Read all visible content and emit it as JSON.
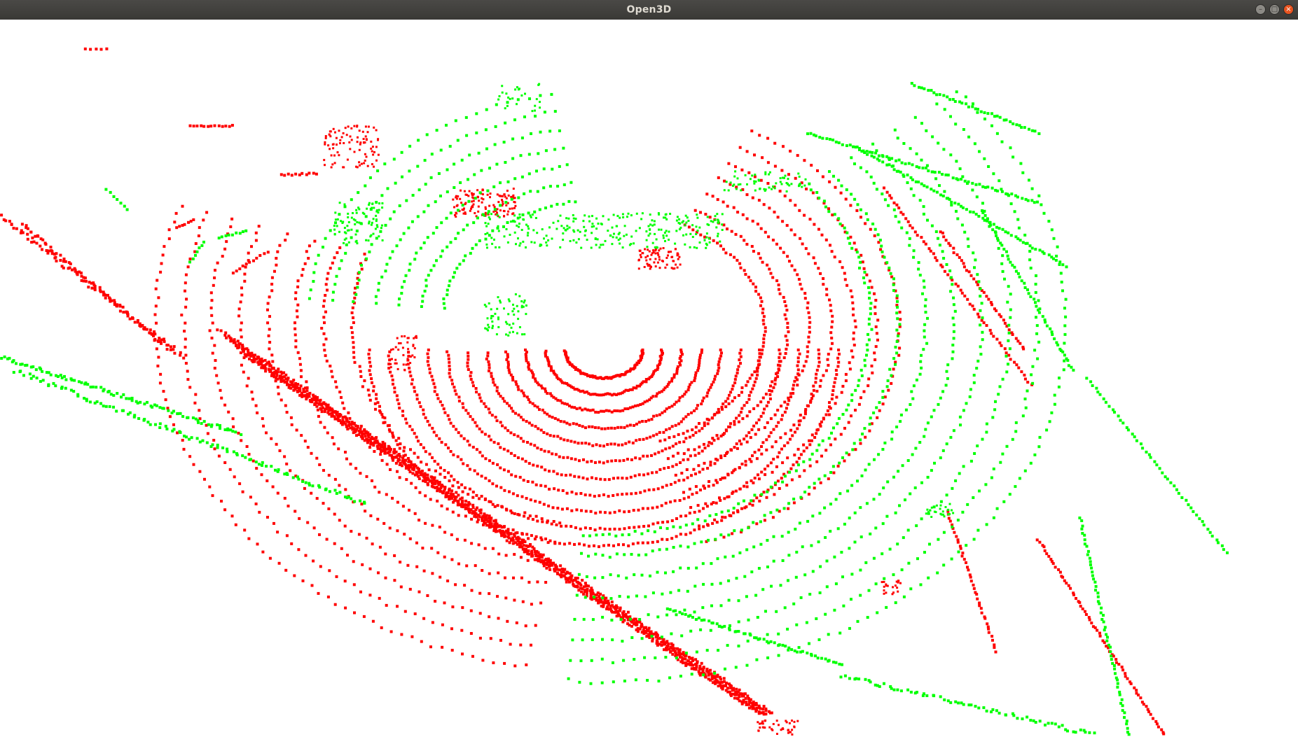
{
  "window": {
    "title": "Open3D",
    "controls": {
      "minimize_icon": "minimize-icon",
      "maximize_icon": "maximize-icon",
      "close_icon": "close-icon"
    }
  },
  "scene": {
    "background_color": "#ffffff",
    "point_colors": {
      "red_cloud": "#ff0000",
      "green_cloud": "#00ff00"
    }
  }
}
